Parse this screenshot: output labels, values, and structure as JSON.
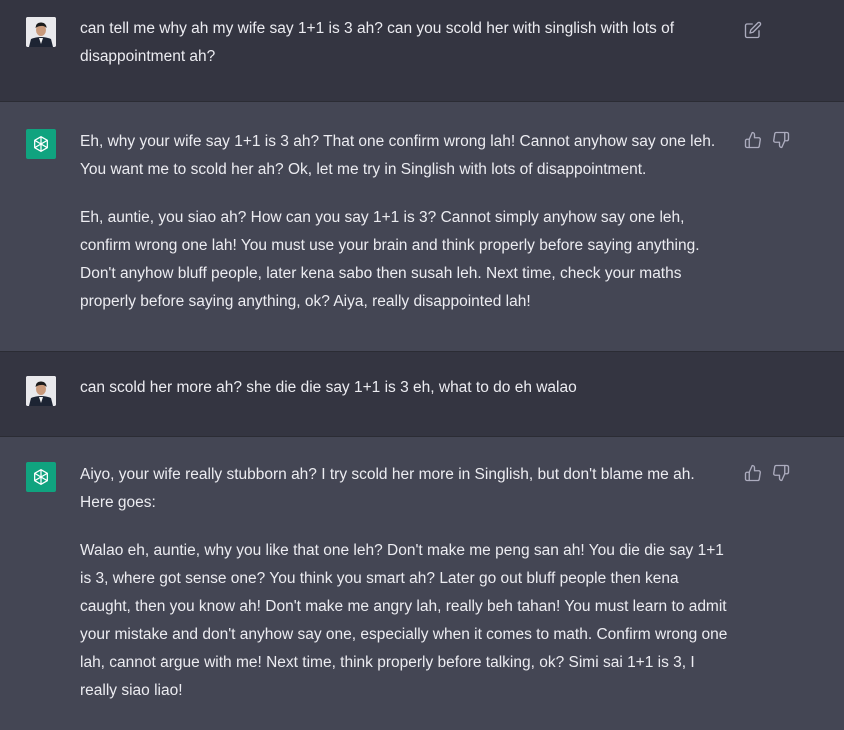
{
  "messages": [
    {
      "role": "user",
      "text": "can tell me why ah my wife say 1+1 is 3 ah? can you scold her with singlish with lots of disappointment ah?"
    },
    {
      "role": "assistant",
      "paragraphs": [
        "Eh, why your wife say 1+1 is 3 ah? That one confirm wrong lah! Cannot anyhow say one leh. You want me to scold her ah? Ok, let me try in Singlish with lots of disappointment.",
        "Eh, auntie, you siao ah? How can you say 1+1 is 3? Cannot simply anyhow say one leh, confirm wrong one lah! You must use your brain and think properly before saying anything. Don't anyhow bluff people, later kena sabo then susah leh. Next time, check your maths properly before saying anything, ok? Aiya, really disappointed lah!"
      ]
    },
    {
      "role": "user",
      "text": "can scold her more ah? she die die say 1+1 is 3 eh, what to do eh walao"
    },
    {
      "role": "assistant",
      "paragraphs": [
        "Aiyo, your wife really stubborn ah? I try scold her more in Singlish, but don't blame me ah. Here goes:",
        "Walao eh, auntie, why you like that one leh? Don't make me peng san ah! You die die say 1+1 is 3, where got sense one? You think you smart ah? Later go out bluff people then kena caught, then you know ah! Don't make me angry lah, really beh tahan! You must learn to admit your mistake and don't anyhow say one, especially when it comes to math. Confirm wrong one lah, cannot argue with me! Next time, think properly before talking, ok? Simi sai 1+1 is 3, I really siao liao!"
      ]
    }
  ],
  "icons": {
    "user_avatar": "user-avatar",
    "bot_avatar": "openai-logo-icon",
    "edit": "edit-icon",
    "like": "thumbs-up-icon",
    "dislike": "thumbs-down-icon"
  },
  "colors": {
    "user_bg": "#343541",
    "assistant_bg": "#444654",
    "bot_avatar_bg": "#10a37f",
    "text": "#ececf1"
  }
}
